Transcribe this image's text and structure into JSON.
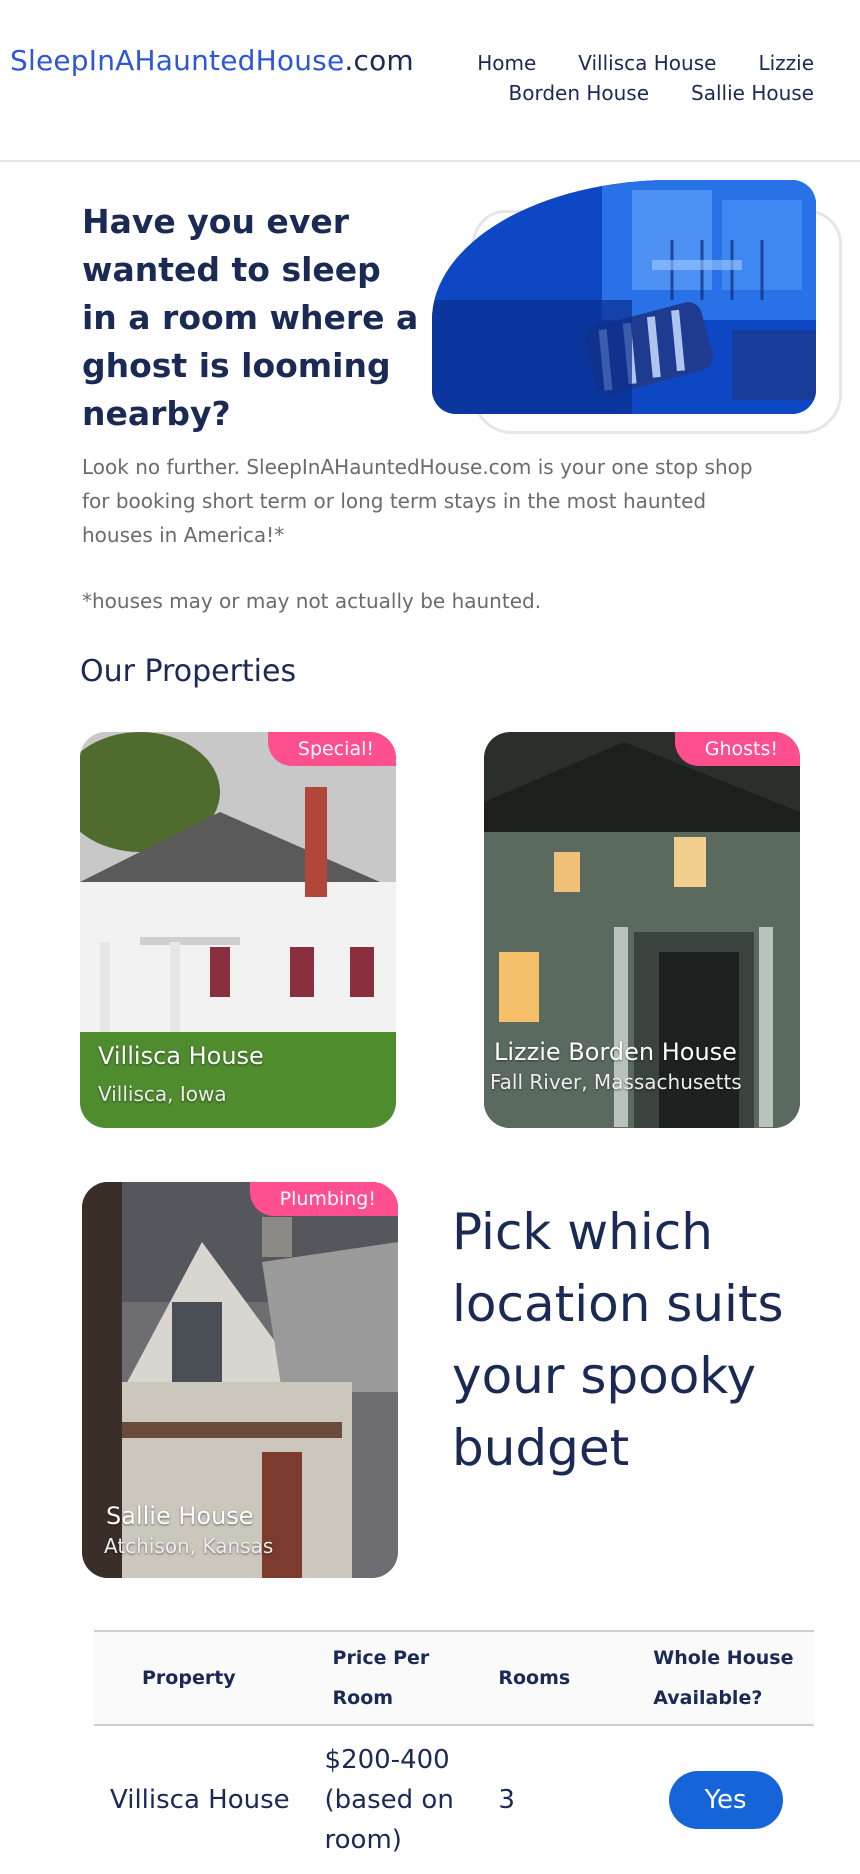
{
  "header": {
    "brand_main": "SleepInAHauntedHouse",
    "brand_tld": ".com",
    "nav_row1": [
      "Home",
      "Villisca House",
      "Lizzie"
    ],
    "nav_row2": [
      "Borden House",
      "Sallie House"
    ]
  },
  "hero": {
    "title": "Have you ever wanted to sleep in a room where a ghost is looming nearby?",
    "intro": "Look no further. SleepInAHauntedHouse.com is your one stop shop for booking short term or long term stays in the most haunted houses in America!*",
    "disclaimer": "*houses may or may not actually be haunted."
  },
  "properties": {
    "section_title": "Our Properties",
    "cards": [
      {
        "name": "Villisca House",
        "location": "Villisca, Iowa",
        "badge": "Special!"
      },
      {
        "name": "Lizzie Borden House",
        "location": "Fall River, Massachusetts",
        "badge": "Ghosts!"
      },
      {
        "name": "Sallie House",
        "location": "Atchison, Kansas",
        "badge": "Plumbing!"
      }
    ],
    "pick_heading": "Pick which location suits your spooky budget"
  },
  "table": {
    "headers": [
      "Property",
      "Price Per Room",
      "Rooms",
      "Whole House Available?"
    ],
    "rows": [
      {
        "property": "Villisca House",
        "price": "$200-400 (based on room)",
        "rooms": "3",
        "whole_house": "Yes"
      }
    ]
  },
  "colors": {
    "brand_blue": "#2d57d6",
    "navy": "#1b2a55",
    "badge_pink": "#ff4f8f",
    "button_blue": "#1565d8"
  }
}
